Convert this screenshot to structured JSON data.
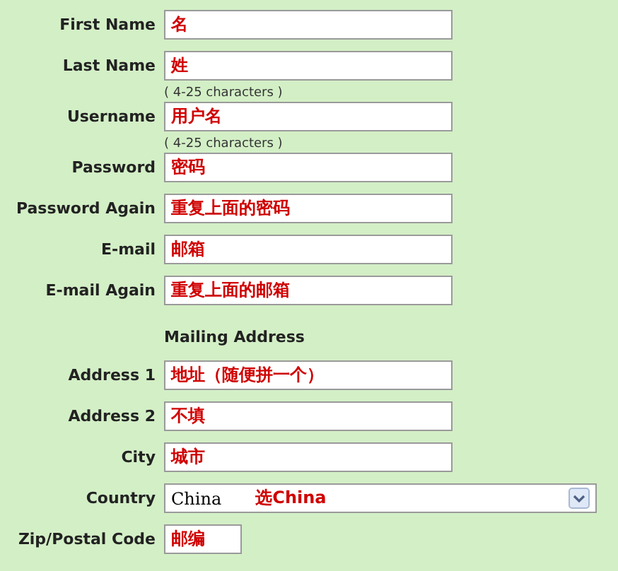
{
  "rows": [
    {
      "kind": "text",
      "label": "First Name",
      "value": "名"
    },
    {
      "kind": "text",
      "label": "Last Name",
      "value": "姓"
    },
    {
      "kind": "text",
      "label": "Username",
      "hint": "( 4-25 characters )",
      "value": "用户名"
    },
    {
      "kind": "text",
      "label": "Password",
      "hint": "( 4-25 characters )",
      "value": "密码"
    },
    {
      "kind": "text",
      "label": "Password Again",
      "value": "重复上面的密码"
    },
    {
      "kind": "text",
      "label": "E-mail",
      "value": "邮箱"
    },
    {
      "kind": "text",
      "label": "E-mail Again",
      "value": "重复上面的邮箱"
    },
    {
      "kind": "heading",
      "label": "Mailing Address"
    },
    {
      "kind": "text",
      "label": "Address 1",
      "value": "地址（随便拼一个）"
    },
    {
      "kind": "text",
      "label": "Address 2",
      "value": "不填"
    },
    {
      "kind": "text",
      "label": "City",
      "value": "城市"
    },
    {
      "kind": "select",
      "label": "Country",
      "value": "China",
      "note": "选China"
    },
    {
      "kind": "short",
      "label": "Zip/Postal Code",
      "value": "邮编"
    }
  ]
}
